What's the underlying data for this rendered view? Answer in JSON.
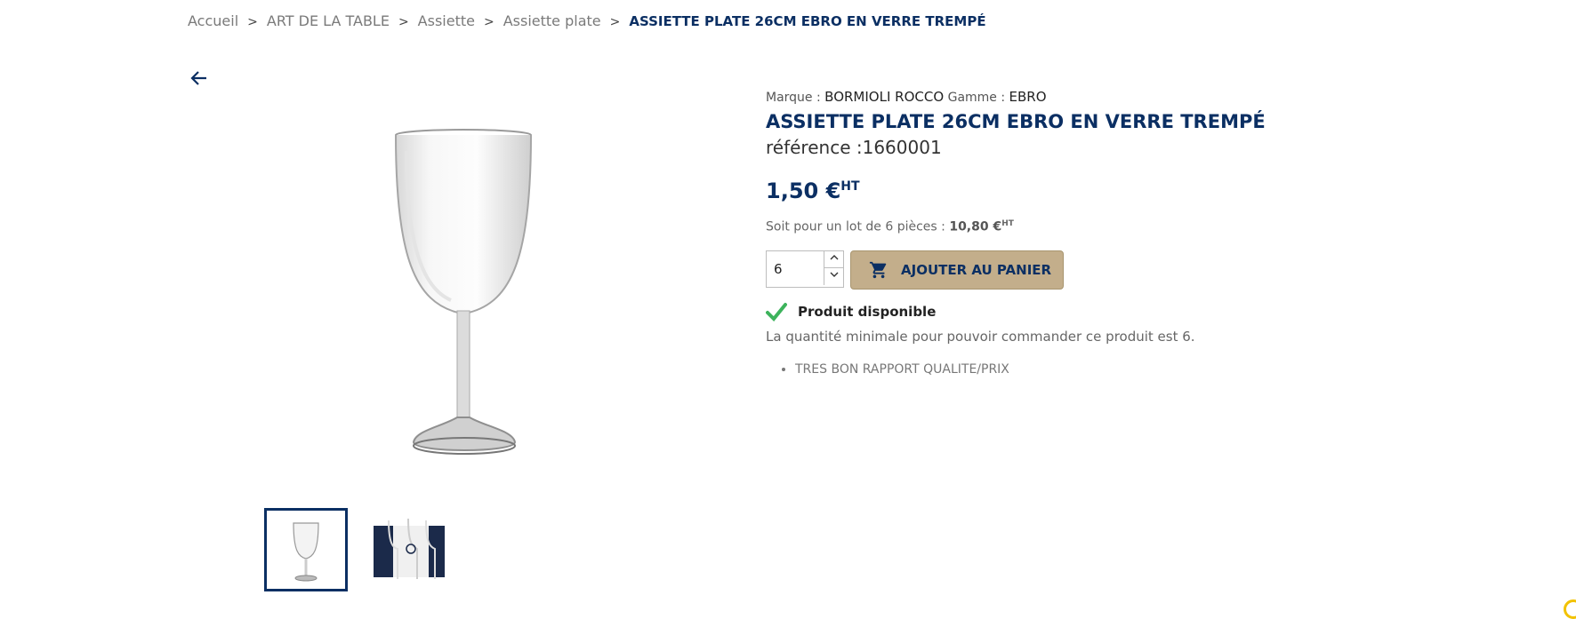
{
  "breadcrumb": {
    "items": [
      "Accueil",
      "ART DE LA TABLE",
      "Assiette",
      "Assiette plate"
    ],
    "current": "ASSIETTE PLATE 26CM EBRO EN VERRE TREMPÉ",
    "separator": ">"
  },
  "product": {
    "brand_label": "Marque :",
    "brand": "BORMIOLI ROCCO",
    "range_label": "Gamme :",
    "range": "EBRO",
    "title": "ASSIETTE PLATE 26CM EBRO EN VERRE TREMPÉ",
    "reference_label": "référence :",
    "reference": "1660001",
    "price": "1,50 €",
    "price_suffix": "HT",
    "lot_text": "Soit pour un lot de 6 pièces :",
    "lot_price": "10,80 €",
    "lot_suffix": "HT",
    "quantity": "6",
    "add_to_cart": "AJOUTER AU PANIER",
    "availability": "Produit disponible",
    "min_qty_text": "La quantité minimale pour pouvoir commander ce produit est 6.",
    "features": [
      "TRES BON RAPPORT QUALITE/PRIX"
    ]
  },
  "icons": {
    "back": "arrow-left-icon",
    "cart": "cart-icon",
    "check": "check-icon",
    "spin_up": "chevron-up-icon",
    "spin_down": "chevron-down-icon"
  },
  "colors": {
    "brand_navy": "#0b2f63",
    "button_beige": "#c3ae8b",
    "check_green": "#3db35c"
  }
}
